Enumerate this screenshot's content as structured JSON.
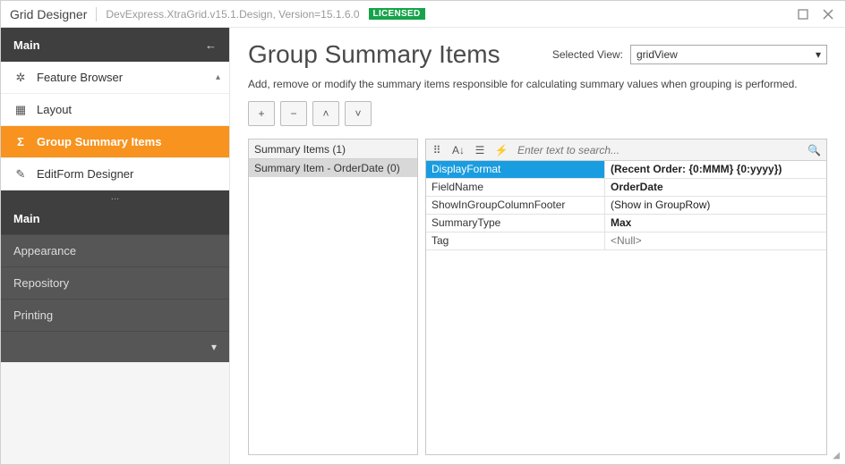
{
  "window": {
    "title": "Grid Designer",
    "meta": "DevExpress.XtraGrid.v15.1.Design, Version=15.1.6.0",
    "license_badge": "LICENSED"
  },
  "sidebar": {
    "header": "Main",
    "items": [
      {
        "icon": "gear-icon",
        "label": "Feature Browser",
        "active": false,
        "caret": true
      },
      {
        "icon": "layout-icon",
        "label": "Layout",
        "active": false
      },
      {
        "icon": "sigma-icon",
        "label": "Group Summary Items",
        "active": true
      },
      {
        "icon": "edit-icon",
        "label": "EditForm Designer",
        "active": false
      }
    ],
    "sections": [
      {
        "label": "Main",
        "bold": true
      },
      {
        "label": "Appearance"
      },
      {
        "label": "Repository"
      },
      {
        "label": "Printing"
      }
    ]
  },
  "main": {
    "heading": "Group Summary Items",
    "selected_view_label": "Selected View:",
    "selected_view_value": "gridView",
    "description": "Add, remove or modify the summary items responsible for calculating summary values when grouping is performed.",
    "toolbar": {
      "add": "+",
      "remove": "−",
      "up": "˄",
      "down": "˅"
    },
    "summary_list": {
      "header": "Summary Items (1)",
      "items": [
        "Summary Item - OrderDate (0)"
      ]
    },
    "property_grid": {
      "search_placeholder": "Enter text to search...",
      "rows": [
        {
          "key": "DisplayFormat",
          "value": "(Recent Order: {0:MMM} {0:yyyy})",
          "selected": true,
          "bold": true
        },
        {
          "key": "FieldName",
          "value": "OrderDate",
          "bold": true
        },
        {
          "key": "ShowInGroupColumnFooter",
          "value": "(Show in GroupRow)"
        },
        {
          "key": "SummaryType",
          "value": "Max",
          "bold": true
        },
        {
          "key": "Tag",
          "value": "<Null>",
          "muted": true
        }
      ]
    }
  }
}
